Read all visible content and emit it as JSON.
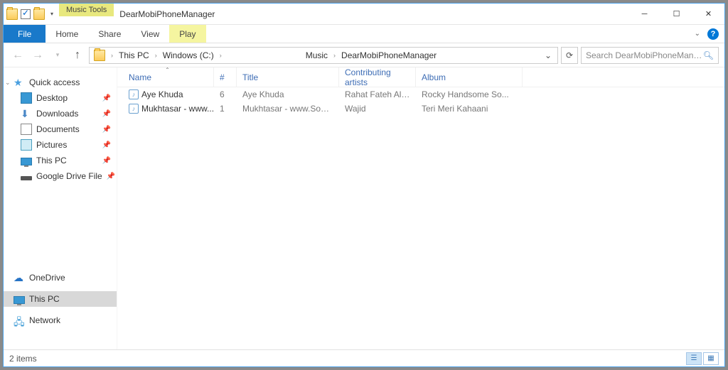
{
  "window": {
    "context_tab": "Music Tools",
    "title": "DearMobiPhoneManager"
  },
  "ribbon": {
    "file": "File",
    "home": "Home",
    "share": "Share",
    "view": "View",
    "play": "Play"
  },
  "breadcrumb": {
    "items": [
      "This PC",
      "Windows (C:)",
      "",
      "Music",
      "DearMobiPhoneManager"
    ]
  },
  "search": {
    "placeholder": "Search DearMobiPhoneMana..."
  },
  "nav": {
    "quick_access": "Quick access",
    "desktop": "Desktop",
    "downloads": "Downloads",
    "documents": "Documents",
    "pictures": "Pictures",
    "this_pc_q": "This PC",
    "gdrive": "Google Drive File",
    "onedrive": "OneDrive",
    "this_pc": "This PC",
    "network": "Network"
  },
  "columns": {
    "name": "Name",
    "num": "#",
    "title": "Title",
    "artists": "Contributing artists",
    "album": "Album"
  },
  "files": [
    {
      "name": "Aye Khuda",
      "num": "6",
      "title": "Aye Khuda",
      "artist": "Rahat Fateh Ali Kh...",
      "album": "Rocky Handsome So..."
    },
    {
      "name": "Mukhtasar - www....",
      "num": "1",
      "title": "Mukhtasar - www.Songs.PK",
      "artist": "Wajid",
      "album": "Teri Meri Kahaani"
    }
  ],
  "status": {
    "count": "2 items"
  }
}
